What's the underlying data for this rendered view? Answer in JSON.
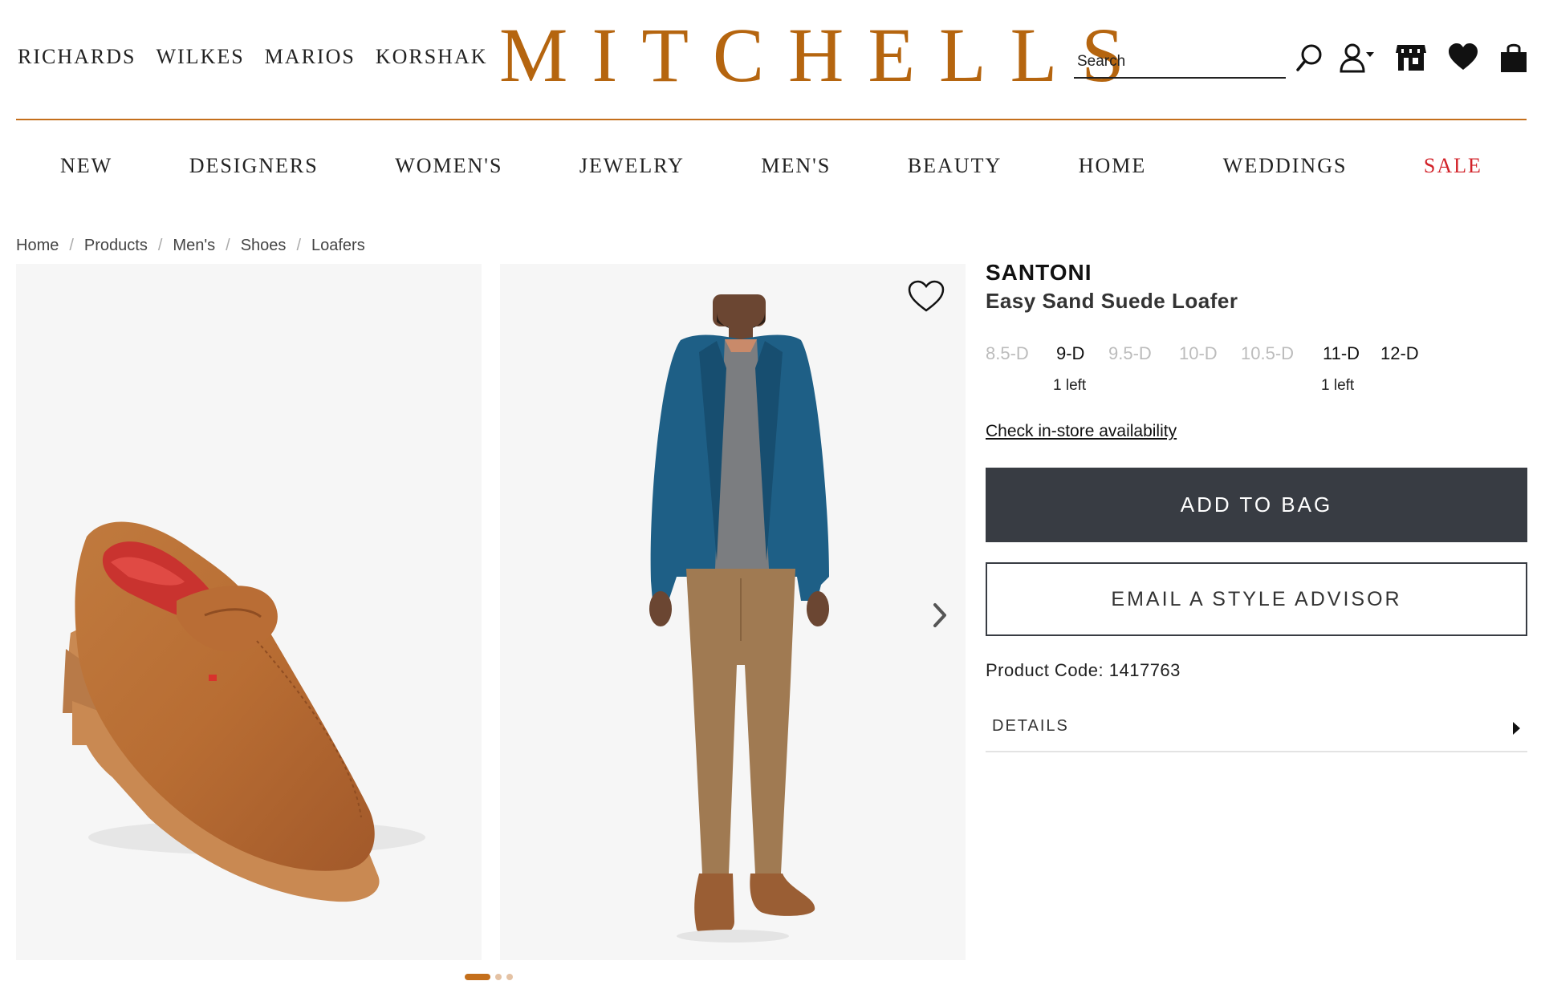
{
  "header": {
    "stores": [
      "RICHARDS",
      "WILKES",
      "MARIOS",
      "KORSHAK"
    ],
    "logo": "MITCHELLS",
    "search_placeholder": "Search",
    "icons": [
      "search-icon",
      "account-icon",
      "store-icon",
      "heart-icon",
      "bag-icon"
    ]
  },
  "nav": {
    "items": [
      "NEW",
      "DESIGNERS",
      "WOMEN'S",
      "JEWELRY",
      "MEN'S",
      "BEAUTY",
      "HOME",
      "WEDDINGS",
      "SALE"
    ]
  },
  "breadcrumb": [
    "Home",
    "Products",
    "Men's",
    "Shoes",
    "Loafers"
  ],
  "product": {
    "brand": "SANTONI",
    "name": "Easy Sand Suede Loafer",
    "sizes": [
      {
        "label": "8.5-D",
        "available": false,
        "stock": ""
      },
      {
        "label": "9-D",
        "available": true,
        "stock": "1 left"
      },
      {
        "label": "9.5-D",
        "available": false,
        "stock": ""
      },
      {
        "label": "10-D",
        "available": false,
        "stock": ""
      },
      {
        "label": "10.5-D",
        "available": false,
        "stock": ""
      },
      {
        "label": "11-D",
        "available": true,
        "stock": "1 left"
      },
      {
        "label": "12-D",
        "available": true,
        "stock": ""
      }
    ],
    "instore_link": "Check in-store availability",
    "add_to_bag": "ADD TO BAG",
    "email_advisor": "EMAIL A STYLE ADVISOR",
    "product_code": "Product Code: 1417763",
    "details_label": "DETAILS"
  },
  "gallery": {
    "images": [
      "loafer-product-image",
      "model-wearing-outfit-image"
    ],
    "active_slide": 1,
    "slide_count": 3
  },
  "colors": {
    "brand_gold": "#b5650f",
    "rule": "#c46f1c",
    "sale_red": "#d2232a",
    "button_dark": "#383c43"
  }
}
